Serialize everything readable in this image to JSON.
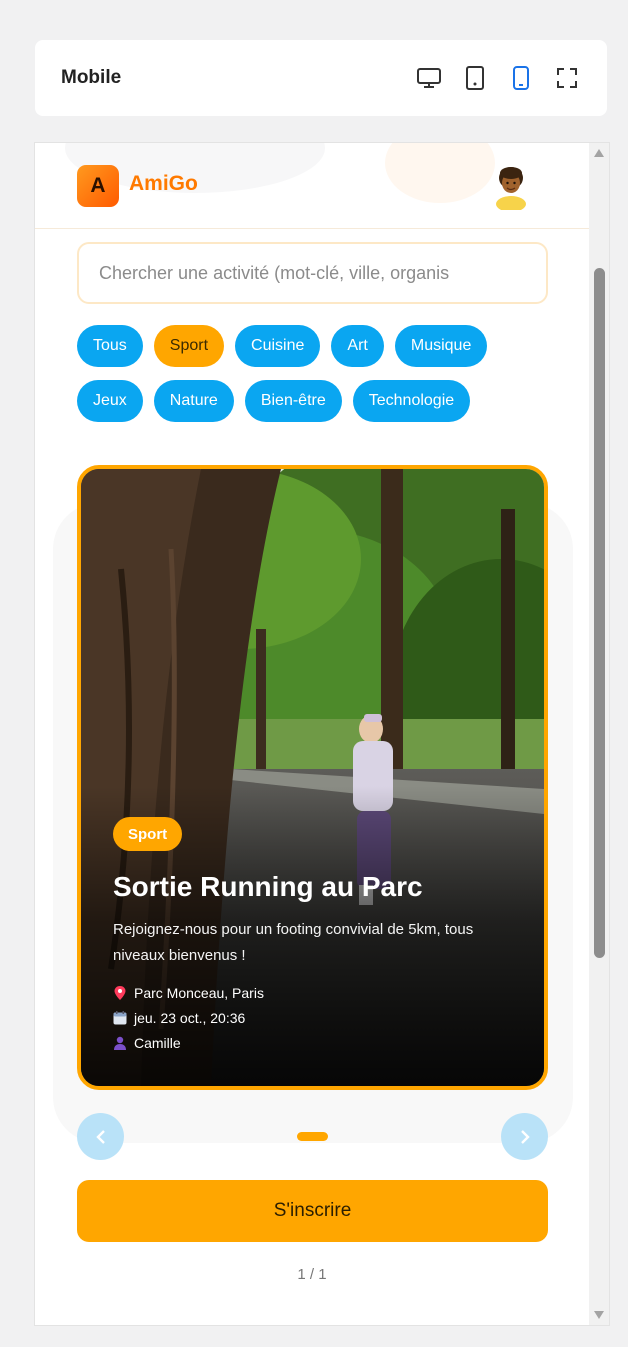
{
  "toolbar": {
    "title": "Mobile",
    "views": [
      {
        "name": "desktop-view-icon",
        "active": false
      },
      {
        "name": "tablet-view-icon",
        "active": false
      },
      {
        "name": "mobile-view-icon",
        "active": true
      },
      {
        "name": "fullscreen-icon",
        "active": false
      }
    ]
  },
  "app": {
    "logo_letter": "A",
    "brand": "AmiGo",
    "avatar_icon": "user-avatar"
  },
  "search": {
    "placeholder": "Chercher une activité (mot-clé, ville, organis",
    "value": ""
  },
  "categories": [
    {
      "label": "Tous",
      "active": false
    },
    {
      "label": "Sport",
      "active": true
    },
    {
      "label": "Cuisine",
      "active": false
    },
    {
      "label": "Art",
      "active": false
    },
    {
      "label": "Musique",
      "active": false
    },
    {
      "label": "Jeux",
      "active": false
    },
    {
      "label": "Nature",
      "active": false
    },
    {
      "label": "Bien-être",
      "active": false
    },
    {
      "label": "Technologie",
      "active": false
    }
  ],
  "card": {
    "tag": "Sport",
    "title": "Sortie Running au Parc",
    "description": "Rejoignez-nous pour un footing convivial de 5km, tous niveaux bienvenus !",
    "location": "Parc Monceau, Paris",
    "date": "jeu. 23 oct., 20:36",
    "organizer": "Camille",
    "icons": {
      "location": "pin-icon",
      "date": "calendar-icon",
      "organizer": "person-icon"
    }
  },
  "carousel": {
    "prev_icon": "chevron-left-icon",
    "next_icon": "chevron-right-icon",
    "current": 1,
    "total": 1
  },
  "cta": {
    "label": "S'inscrire"
  },
  "pager": {
    "text": "1 / 1"
  },
  "colors": {
    "accent": "#ffa600",
    "chip": "#0aa6f1",
    "brand": "#ff7a00"
  }
}
